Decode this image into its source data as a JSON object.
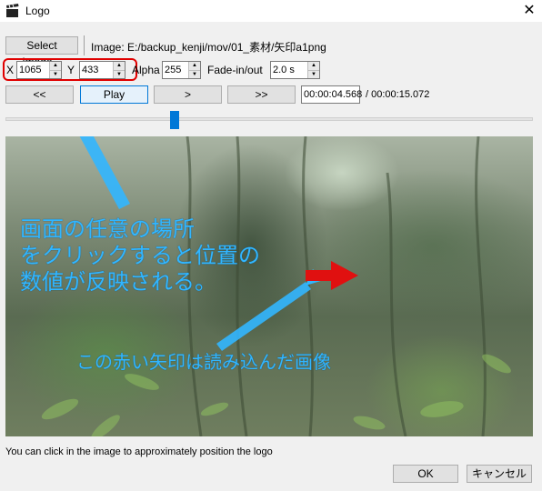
{
  "window": {
    "title": "Logo",
    "close_glyph": "✕"
  },
  "toolbar": {
    "select_image_label": "Select Image...",
    "image_path": "Image: E:/backup_kenji/mov/01_素材/矢印a1png"
  },
  "params": {
    "x_label": "X",
    "x_value": "1065",
    "y_label": "Y",
    "y_value": "433",
    "alpha_label": "Alpha",
    "alpha_value": "255",
    "fade_label": "Fade-in/out",
    "fade_value": "2.0 s"
  },
  "playback": {
    "prev_label": "<<",
    "play_label": "Play",
    "next_label": ">",
    "fast_label": ">>",
    "current_time": "00:00:04.568",
    "total_time": "/ 00:00:15.072",
    "slider_fraction": 0.32
  },
  "annotations": {
    "line1": "画面の任意の場所",
    "line2": "をクリックすると位置の",
    "line3": "数値が反映される。",
    "arrow_caption": "この赤い矢印は読み込んだ画像",
    "accent_color": "#32b6ff",
    "logo_arrow_color": "#e01010"
  },
  "status_text": "You can click in the image to approximately position the logo",
  "footer": {
    "ok_label": "OK",
    "cancel_label": "キャンセル"
  }
}
